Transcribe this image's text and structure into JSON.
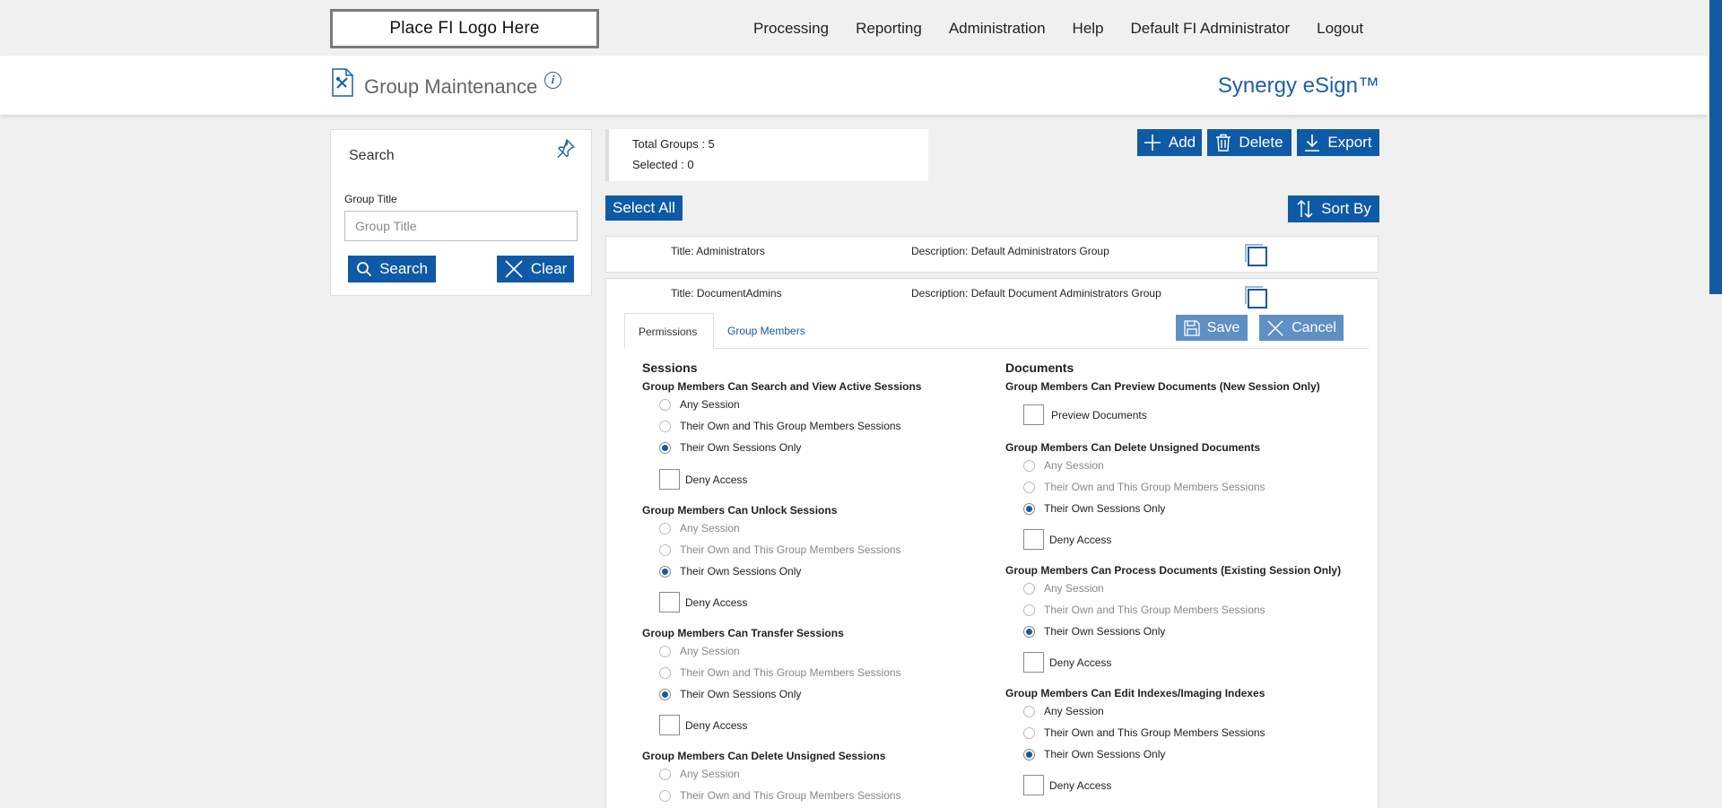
{
  "topbar": {
    "logo_text": "Place FI Logo Here",
    "nav": [
      "Processing",
      "Reporting",
      "Administration",
      "Help",
      "Default FI Administrator",
      "Logout"
    ]
  },
  "header": {
    "title": "Group Maintenance",
    "brand": "Synergy eSign™"
  },
  "search_panel": {
    "title": "Search",
    "group_title_label": "Group Title",
    "group_title_placeholder": "Group Title",
    "group_title_value": "",
    "search_label": "Search",
    "clear_label": "Clear"
  },
  "summary": {
    "total_groups": "Total Groups : 5",
    "selected": "Selected : 0"
  },
  "toolbar": {
    "add_label": "Add",
    "delete_label": "Delete",
    "export_label": "Export",
    "select_all_label": "Select All",
    "sort_by_label": "Sort By"
  },
  "groups": [
    {
      "title": "Title:  Administrators",
      "description": "Description: Default Administrators Group"
    },
    {
      "title": "Title:  DocumentAdmins",
      "description": "Description: Default Document Administrators Group"
    }
  ],
  "editor": {
    "tab_permissions": "Permissions",
    "tab_members": "Group Members",
    "save_label": "Save",
    "cancel_label": "Cancel"
  },
  "options": {
    "any": "Any Session",
    "own_group": "Their Own and This Group Members Sessions",
    "own_only": "Their Own Sessions Only",
    "deny": "Deny Access"
  },
  "sessions": {
    "title": "Sessions",
    "q1": "Group Members Can Search and View Active Sessions",
    "q2": "Group Members Can Unlock Sessions",
    "q3": "Group Members Can Transfer Sessions",
    "q4": "Group Members Can Delete Unsigned Sessions"
  },
  "documents": {
    "title": "Documents",
    "q1": "Group Members Can Preview Documents (New Session Only)",
    "preview_label": "Preview Documents",
    "q2": "Group Members Can Delete Unsigned Documents",
    "q3": "Group Members Can Process Documents (Existing Session Only)",
    "q4": "Group Members Can Edit Indexes/Imaging Indexes"
  },
  "colors": {
    "accent": "#0f5aa6",
    "disabled_button": "#5e90c4",
    "brand_text": "#1f5fa6"
  }
}
